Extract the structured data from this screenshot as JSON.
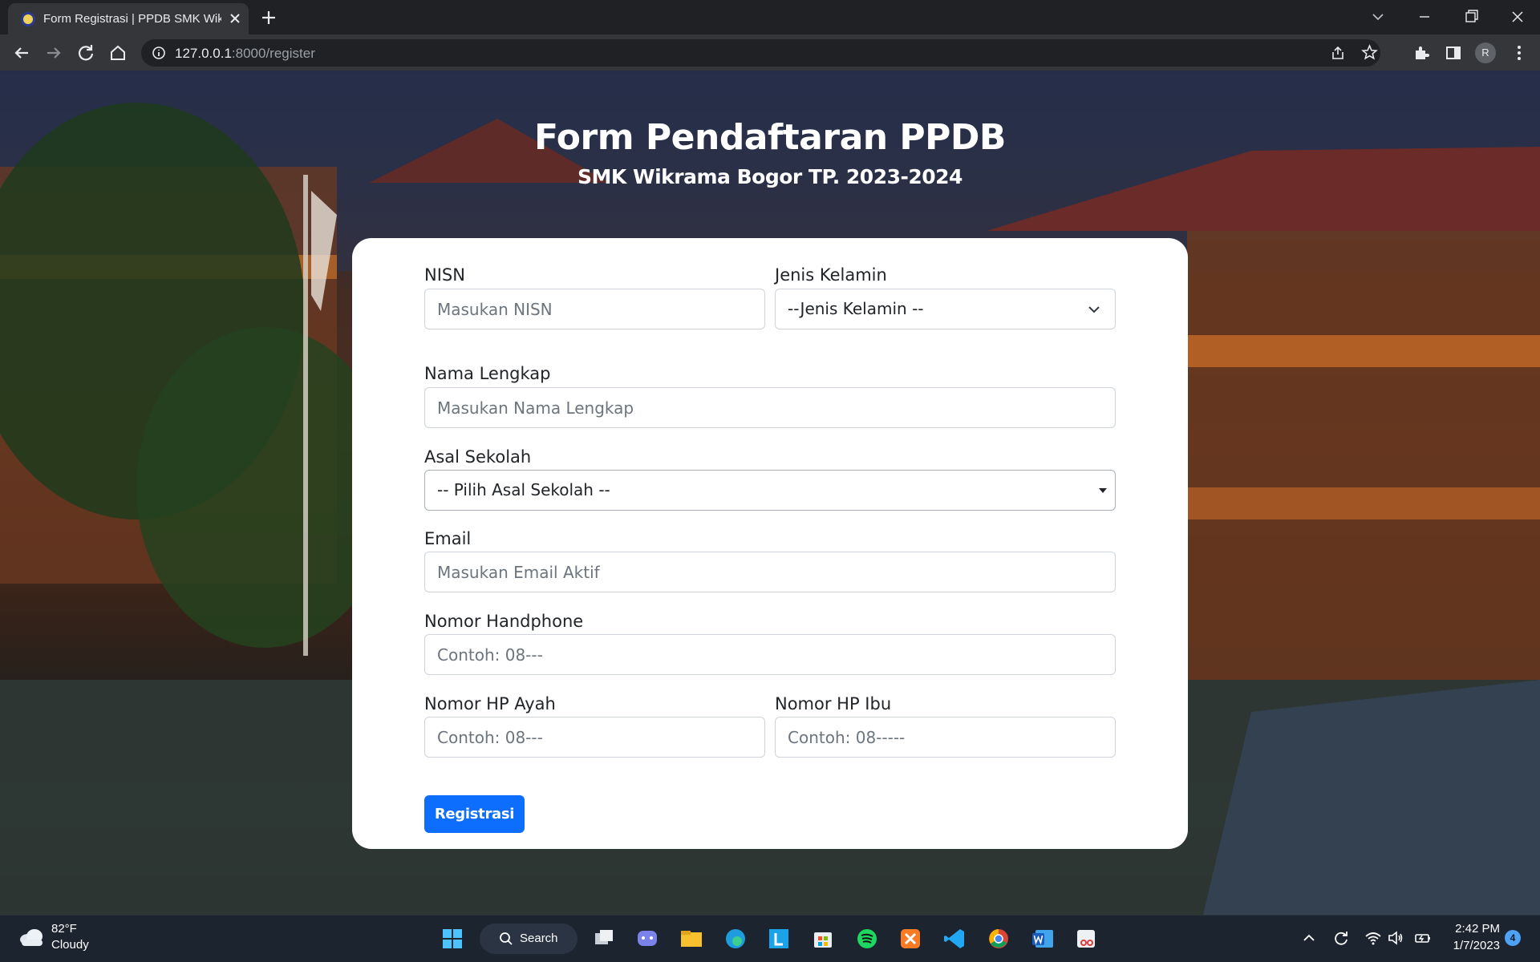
{
  "browser": {
    "tab_title": "Form Registrasi | PPDB SMK Wikrama",
    "url_host": "127.0.0.1",
    "url_rest": ":8000/register",
    "profile_initial": "R"
  },
  "page": {
    "title": "Form Pendaftaran PPDB",
    "subtitle": "SMK Wikrama Bogor TP. 2023-2024"
  },
  "form": {
    "nisn": {
      "label": "NISN",
      "placeholder": "Masukan NISN"
    },
    "gender": {
      "label": "Jenis Kelamin",
      "selected": "--Jenis Kelamin --"
    },
    "full_name": {
      "label": "Nama Lengkap",
      "placeholder": "Masukan Nama Lengkap"
    },
    "school": {
      "label": "Asal Sekolah",
      "selected": "-- Pilih Asal Sekolah --"
    },
    "email": {
      "label": "Email",
      "placeholder": "Masukan Email Aktif"
    },
    "phone": {
      "label": "Nomor Handphone",
      "placeholder": "Contoh: 08---"
    },
    "father_phone": {
      "label": "Nomor HP Ayah",
      "placeholder": "Contoh: 08---"
    },
    "mother_phone": {
      "label": "Nomor HP Ibu",
      "placeholder": "Contoh: 08-----"
    },
    "submit_label": "Registrasi"
  },
  "taskbar": {
    "weather_temp": "82°F",
    "weather_desc": "Cloudy",
    "search_label": "Search",
    "clock_time": "2:42 PM",
    "clock_date": "1/7/2023",
    "notification_count": "4"
  },
  "colors": {
    "primary_button": "#0d6efd",
    "card_background": "#ffffff"
  }
}
